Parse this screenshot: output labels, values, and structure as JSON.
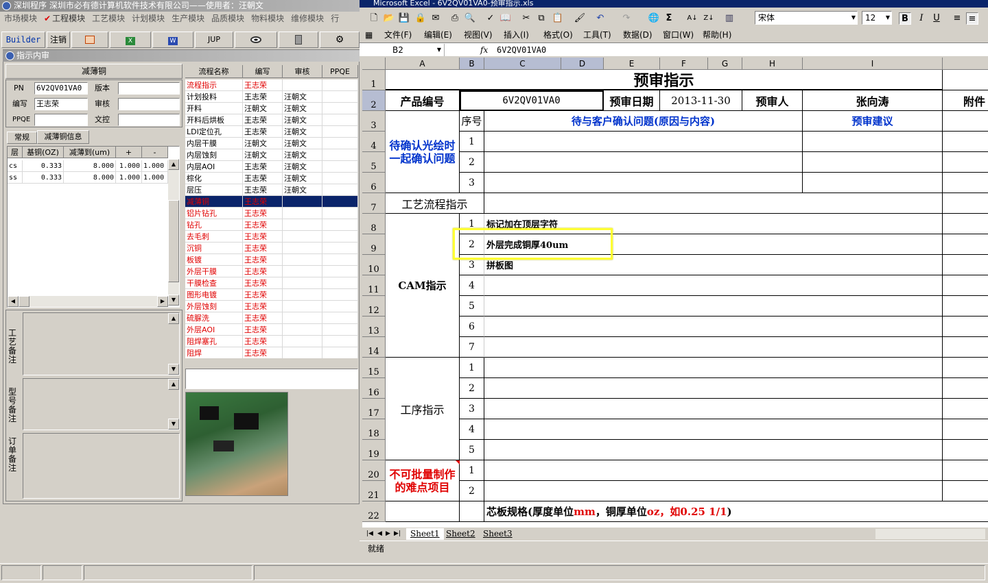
{
  "left_app": {
    "title": "深圳程序  深圳市必有德计算机软件技术有限公司——使用者：汪朝文",
    "menu": [
      "市场模块",
      "工程模块",
      "工艺模块",
      "计划模块",
      "生产模块",
      "品质模块",
      "物料模块",
      "维修模块",
      "行"
    ],
    "toolbar": {
      "builder": "Builder",
      "logout": "注销",
      "jup": "JUP"
    },
    "window_title": "指示内审",
    "panel_header": "减薄铜",
    "fields": {
      "pn_label": "PN",
      "pn_value": "6V2QV01VA0",
      "author_label": "编写",
      "author_value": "王志荣",
      "ppqe_label": "PPQE",
      "version_label": "版本",
      "review_label": "审核",
      "control_label": "文控"
    },
    "tabs": [
      "常规",
      "减薄铜信息"
    ],
    "layer_grid": {
      "headers": [
        "层",
        "基铜(OZ)",
        "减薄到(um)",
        "+",
        "-"
      ],
      "rows": [
        [
          "cs",
          "0.333",
          "8.000",
          "1.000",
          "1.000"
        ],
        [
          "ss",
          "0.333",
          "8.000",
          "1.000",
          "1.000"
        ]
      ]
    },
    "flow_grid": {
      "headers": [
        "流程名称",
        "编写",
        "审核",
        "PPQE"
      ],
      "rows": [
        {
          "name": "流程指示",
          "author": "王志荣",
          "review": "",
          "red": true
        },
        {
          "name": "计划投料",
          "author": "王志荣",
          "review": "汪朝文",
          "red": false
        },
        {
          "name": "开料",
          "author": "汪朝文",
          "review": "汪朝文",
          "red": false
        },
        {
          "name": "开料后烘板",
          "author": "王志荣",
          "review": "汪朝文",
          "red": false
        },
        {
          "name": "LDI定位孔",
          "author": "王志荣",
          "review": "汪朝文",
          "red": false
        },
        {
          "name": "内层干膜",
          "author": "汪朝文",
          "review": "汪朝文",
          "red": false
        },
        {
          "name": "内层蚀刻",
          "author": "汪朝文",
          "review": "汪朝文",
          "red": false
        },
        {
          "name": "内层AOI",
          "author": "王志荣",
          "review": "汪朝文",
          "red": false
        },
        {
          "name": "棕化",
          "author": "王志荣",
          "review": "汪朝文",
          "red": false
        },
        {
          "name": "层压",
          "author": "王志荣",
          "review": "汪朝文",
          "red": false
        },
        {
          "name": "减薄铜",
          "author": "王志荣",
          "review": "",
          "red": true,
          "selected": true
        },
        {
          "name": "铝片钻孔",
          "author": "王志荣",
          "review": "",
          "red": true
        },
        {
          "name": "钻孔",
          "author": "王志荣",
          "review": "",
          "red": true
        },
        {
          "name": "去毛刺",
          "author": "王志荣",
          "review": "",
          "red": true
        },
        {
          "name": "沉铜",
          "author": "王志荣",
          "review": "",
          "red": true
        },
        {
          "name": "板镀",
          "author": "王志荣",
          "review": "",
          "red": true
        },
        {
          "name": "外层干膜",
          "author": "王志荣",
          "review": "",
          "red": true
        },
        {
          "name": "干膜检查",
          "author": "王志荣",
          "review": "",
          "red": true
        },
        {
          "name": "图形电镀",
          "author": "王志荣",
          "review": "",
          "red": true
        },
        {
          "name": "外层蚀刻",
          "author": "王志荣",
          "review": "",
          "red": true
        },
        {
          "name": "硫脲洗",
          "author": "王志荣",
          "review": "",
          "red": true
        },
        {
          "name": "外层AOI",
          "author": "王志荣",
          "review": "",
          "red": true
        },
        {
          "name": "阻焊塞孔",
          "author": "王志荣",
          "review": "",
          "red": true
        },
        {
          "name": "阻焊",
          "author": "王志荣",
          "review": "",
          "red": true
        }
      ]
    },
    "remarks": [
      "工艺备注",
      "型号备注",
      "订单备注"
    ]
  },
  "excel": {
    "title": "Microsoft Excel - 6V2QV01VA0-预审指示.xls",
    "font_name": "宋体",
    "font_size": "12",
    "menu": [
      "文件(F)",
      "编辑(E)",
      "视图(V)",
      "插入(I)",
      "格式(O)",
      "工具(T)",
      "数据(D)",
      "窗口(W)",
      "帮助(H)"
    ],
    "name_box": "B2",
    "fx": "fx",
    "formula": "6V2QV01VA0",
    "columns": [
      "A",
      "B",
      "C",
      "D",
      "E",
      "F",
      "G",
      "H",
      "I"
    ],
    "rows": [
      "1",
      "2",
      "3",
      "4",
      "5",
      "6",
      "7",
      "8",
      "9",
      "10",
      "11",
      "12",
      "13",
      "14",
      "15",
      "16",
      "17",
      "18",
      "19",
      "20",
      "21",
      "22"
    ],
    "cells": {
      "title": "预审指示",
      "product_no_label": "产品编号",
      "product_no": "6V2QV01VA0",
      "review_date_label": "预审日期",
      "review_date": "2013-11-30",
      "reviewer_label": "预审人",
      "reviewer": "张向涛",
      "attach_label": "附件",
      "seq_label": "序号",
      "confirm_label": "待与客户确认问题(原因与内容)",
      "suggest_label": "预审建议",
      "pending_label": "待确认光绘时一起确认问题",
      "pending_nums": [
        "1",
        "2",
        "3"
      ],
      "process_label": "工艺流程指示",
      "cam_label": "CAM指示",
      "cam_nums": [
        "1",
        "2",
        "3",
        "4",
        "5",
        "6",
        "7"
      ],
      "cam_items": [
        "标记加在顶层字符",
        "外层完成铜厚40um",
        "拼板图"
      ],
      "step_label": "工序指示",
      "step_nums": [
        "1",
        "2",
        "3",
        "4",
        "5"
      ],
      "hard_label": "不可批量制作的难点项目",
      "hard_nums": [
        "1",
        "2"
      ],
      "core_label_a": "芯板规格(厚度单位",
      "core_mm": "mm",
      "core_label_b": "，铜厚单位",
      "core_oz": "oz",
      "core_label_c": "，如0.25 1/1",
      "core_label_d": ")"
    },
    "sheets": [
      "Sheet1",
      "Sheet2",
      "Sheet3"
    ],
    "status": "就绪"
  }
}
